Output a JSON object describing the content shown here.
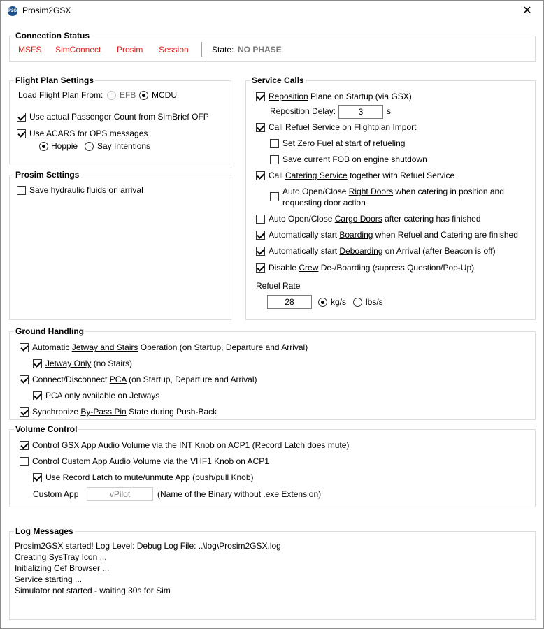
{
  "window": {
    "title": "Prosim2GSX",
    "close_glyph": "✕",
    "icon_text": "P2G"
  },
  "connection": {
    "title": "Connection Status",
    "items": [
      "MSFS",
      "SimConnect",
      "Prosim",
      "Session"
    ],
    "state_label": "State:",
    "state_value": "NO PHASE",
    "status_color": "#e02020"
  },
  "flight_plan": {
    "title": "Flight Plan Settings",
    "load_label": "Load Flight Plan From:",
    "opt_efb": "EFB",
    "opt_mcdu": "MCDU",
    "selected": "MCDU",
    "pax_count": {
      "label": "Use actual Passenger Count from SimBrief OFP",
      "checked": true
    },
    "acars": {
      "label": "Use ACARS for OPS messages",
      "checked": true
    },
    "opt_hoppie": "Hoppie",
    "opt_say": "Say Intentions",
    "acars_selected": "Hoppie"
  },
  "prosim": {
    "title": "Prosim Settings",
    "hydraulic": {
      "label": "Save hydraulic fluids on arrival",
      "checked": false
    }
  },
  "service": {
    "title": "Service Calls",
    "reposition_pre": "Reposition",
    "reposition_post": " Plane on Startup (via GSX)",
    "delay_label": "Reposition Delay:",
    "delay_value": "3",
    "delay_unit": "s",
    "refuel_pre": "Call ",
    "refuel_link": "Refuel Service",
    "refuel_post": " on Flightplan Import",
    "zero_fuel": "Set Zero Fuel at start of refueling",
    "save_fob": "Save current FOB on engine shutdown",
    "catering_pre": "Call ",
    "catering_link": "Catering Service",
    "catering_post": " together with Refuel Service",
    "doors_pre": "Auto Open/Close ",
    "doors_link": "Right Doors",
    "doors_post": " when catering in position and",
    "doors_line2": "requesting door action",
    "cargo_pre": "Auto Open/Close ",
    "cargo_link": "Cargo Doors",
    "cargo_post": " after catering has finished",
    "boarding_pre": "Automatically start ",
    "boarding_link": "Boarding",
    "boarding_post": " when Refuel and Catering are finished",
    "deboarding_pre": "Automatically start ",
    "deboarding_link": "Deboarding",
    "deboarding_post": " on Arrival (after Beacon is off)",
    "crew_pre": "Disable ",
    "crew_link": "Crew",
    "crew_post": " De-/Boarding (supress Question/Pop-Up)",
    "refuel_rate_label": "Refuel Rate",
    "refuel_rate_value": "28",
    "unit_kgs": "kg/s",
    "unit_lbs": "lbs/s",
    "unit_selected": "kg/s",
    "checked": {
      "reposition": true,
      "refuel": true,
      "zero_fuel": false,
      "save_fob": false,
      "catering": true,
      "doors": false,
      "cargo": false,
      "boarding": true,
      "deboarding": true,
      "crew": true
    }
  },
  "ground": {
    "title": "Ground Handling",
    "jetway_pre": "Automatic ",
    "jetway_link": "Jetway and Stairs",
    "jetway_post": " Operation (on Startup, Departure and Arrival)",
    "jetway_only_link": "Jetway Only",
    "jetway_only_post": " (no Stairs)",
    "pca_pre": "Connect/Disconnect ",
    "pca_link": "PCA",
    "pca_post": " (on Startup, Departure and Arrival)",
    "pca_jetways": "PCA only available on Jetways",
    "bypass_pre": "Synchronize ",
    "bypass_link": "By-Pass Pin",
    "bypass_post": " State during Push-Back",
    "checked": {
      "jetway": true,
      "jetway_only": true,
      "pca": true,
      "pca_jetways": true,
      "bypass": true
    }
  },
  "volume": {
    "title": "Volume Control",
    "gsx_pre": "Control ",
    "gsx_link": "GSX App Audio",
    "gsx_post": " Volume via the INT Knob on ACP1 (Record Latch does mute)",
    "custom_pre": "Control ",
    "custom_link": "Custom App Audio",
    "custom_post": " Volume via the VHF1 Knob on ACP1",
    "latch": "Use Record Latch to mute/unmute App (push/pull Knob)",
    "custom_app_label": "Custom App",
    "custom_app_value": "vPilot",
    "custom_app_hint": "(Name of the Binary without .exe Extension)",
    "checked": {
      "gsx": true,
      "custom": false,
      "latch": true
    }
  },
  "log": {
    "title": "Log Messages",
    "lines": [
      "Prosim2GSX started! Log Level: Debug Log File: ..\\log\\Prosim2GSX.log",
      "Creating SysTray Icon ...",
      "Initializing Cef Browser ...",
      "Service starting ...",
      "Simulator not started - waiting 30s for Sim"
    ]
  }
}
